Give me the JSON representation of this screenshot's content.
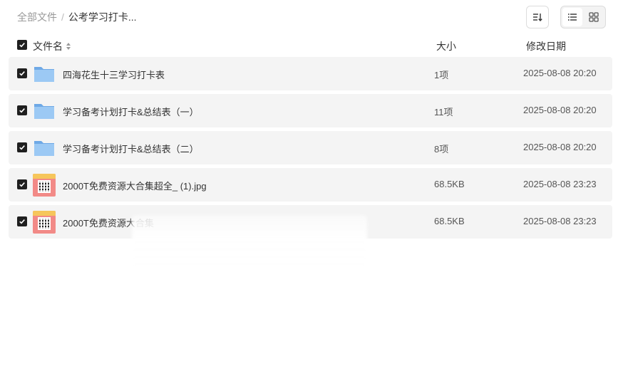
{
  "breadcrumb": {
    "root": "全部文件",
    "separator": "/",
    "current": "公考学习打卡..."
  },
  "toolbar": {
    "sort_icon": "sort-icon",
    "list_view_icon": "list-view-icon",
    "grid_view_icon": "grid-view-icon",
    "active_view": "list"
  },
  "columns": {
    "name": "文件名",
    "size": "大小",
    "date": "修改日期"
  },
  "files": [
    {
      "name": "四海花生十三学习打卡表",
      "size": "1项",
      "date": "2025-08-08 20:20",
      "type": "folder",
      "checked": true
    },
    {
      "name": "学习备考计划打卡&总结表（一）",
      "size": "11项",
      "date": "2025-08-08 20:20",
      "type": "folder",
      "checked": true
    },
    {
      "name": "学习备考计划打卡&总结表（二）",
      "size": "8项",
      "date": "2025-08-08 20:20",
      "type": "folder",
      "checked": true
    },
    {
      "name": "2000T免费资源大合集超全_ (1).jpg",
      "size": "68.5KB",
      "date": "2025-08-08 23:23",
      "type": "image",
      "checked": true
    },
    {
      "name": "2000T免费资源大合集",
      "size": "68.5KB",
      "date": "2025-08-08 23:23",
      "type": "image",
      "checked": true
    }
  ],
  "colors": {
    "row_bg": "#f4f4f4",
    "checkbox": "#1f1f1f",
    "folder": "#7fb8ee",
    "muted_text": "#999999"
  }
}
